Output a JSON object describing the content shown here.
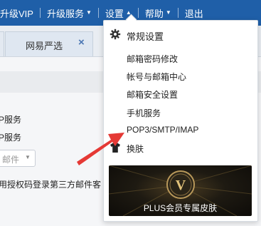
{
  "topbar": {
    "items": [
      {
        "label": "升级VIP",
        "chevron": false
      },
      {
        "label": "升级服务",
        "chevron": true
      },
      {
        "label": "设置",
        "chevron": true,
        "chevron_dir": "up"
      },
      {
        "label": "帮助",
        "chevron": true
      },
      {
        "label": "退出",
        "chevron": false
      }
    ],
    "color": "#1f5fa8"
  },
  "tabs": {
    "active_label": "网易严选",
    "close_symbol": "×"
  },
  "content": {
    "lines": [
      "P服务",
      "P服务",
      "用授权码登录第三方邮件客"
    ],
    "combo_value": "邮件"
  },
  "menu": {
    "items": [
      {
        "label": "常规设置",
        "icon": "gear-icon"
      },
      {
        "label": "邮箱密码修改"
      },
      {
        "label": "帐号与邮箱中心"
      },
      {
        "label": "邮箱安全设置"
      },
      {
        "label": "手机服务"
      },
      {
        "label": "POP3/SMTP/IMAP"
      },
      {
        "label": "换肤",
        "icon": "tshirt-icon"
      }
    ],
    "promo": {
      "badge_letter": "V",
      "text": "PLUS会员专属皮肤"
    }
  },
  "annotation": {
    "arrow_color": "#e53935"
  }
}
